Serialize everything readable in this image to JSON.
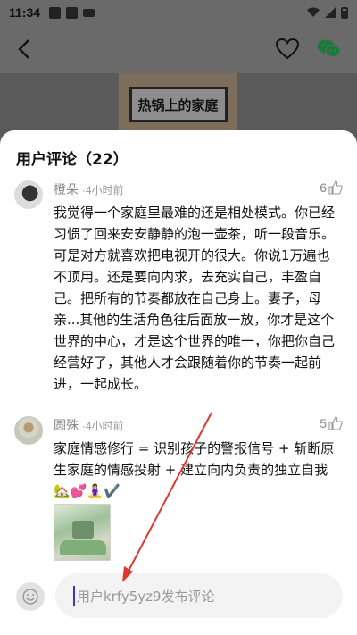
{
  "status_bar": {
    "time": "11:34"
  },
  "cover": {
    "sign_text": "热锅上的家庭"
  },
  "comments_sheet": {
    "title": "用户评论（22）",
    "comments": [
      {
        "username": "橙朵",
        "time": "·4小时前",
        "likes": "6",
        "text": "我觉得一个家庭里最难的还是相处模式。你已经习惯了回来安安静静的泡一壶茶，听一段音乐。可是对方就喜欢把电视开的很大。你说1万遍也不顶用。还是要向内求，去充实自己，丰盈自己。把所有的节奏都放在自己身上。妻子，母亲...其他的生活角色往后面放一放，你才是这个世界的中心，才是这个世界的唯一，你把你自己经营好了，其他人才会跟随着你的节奏一起前进，一起成长。"
      },
      {
        "username": "圆殊",
        "time": "·4小时前",
        "likes": "5",
        "text": "家庭情感修行 = 识别孩子的警报信号 + 斩断原生家庭的情感投射 + 建立向内负责的独立自我",
        "emojis": "🏡💕🧘‍♀️✔️"
      }
    ]
  },
  "input_bar": {
    "placeholder": "用户krfy5yz9发布评论"
  },
  "colors": {
    "annotation_arrow": "#e0382e",
    "caret": "#3b35c9"
  }
}
